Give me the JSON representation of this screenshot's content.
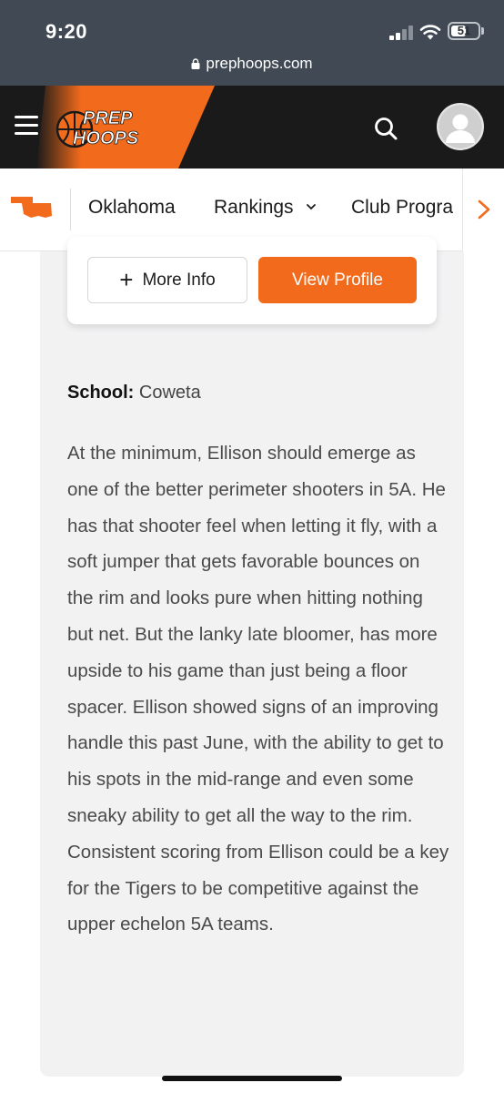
{
  "status_bar": {
    "time": "9:20",
    "battery": "51",
    "url": "prephoops.com"
  },
  "header": {
    "logo_line1": "PREP",
    "logo_line2": "HOOPS",
    "brand_color": "#f26a1b"
  },
  "subnav": {
    "items": [
      {
        "label": "Oklahoma"
      },
      {
        "label": "Rankings"
      },
      {
        "label": "Club Progra"
      }
    ]
  },
  "profile_actions": {
    "more_info": "More Info",
    "view_profile": "View Profile"
  },
  "school": {
    "label": "School:",
    "value": "Coweta"
  },
  "article": {
    "text": "At the minimum, Ellison should emerge as one of the better perimeter shooters in 5A. He has that shooter feel when letting it fly, with a soft jumper that gets favorable bounces on the rim and looks pure when hitting nothing but net. But the lanky late bloomer, has more upside to his game than just being a floor spacer. Ellison showed signs of an improving handle this past June, with the ability to get to his spots in the mid-range and even some sneaky ability to get all the way to the rim. Consistent scoring from Ellison could be a key for the Tigers to be competitive against the upper echelon 5A teams."
  }
}
